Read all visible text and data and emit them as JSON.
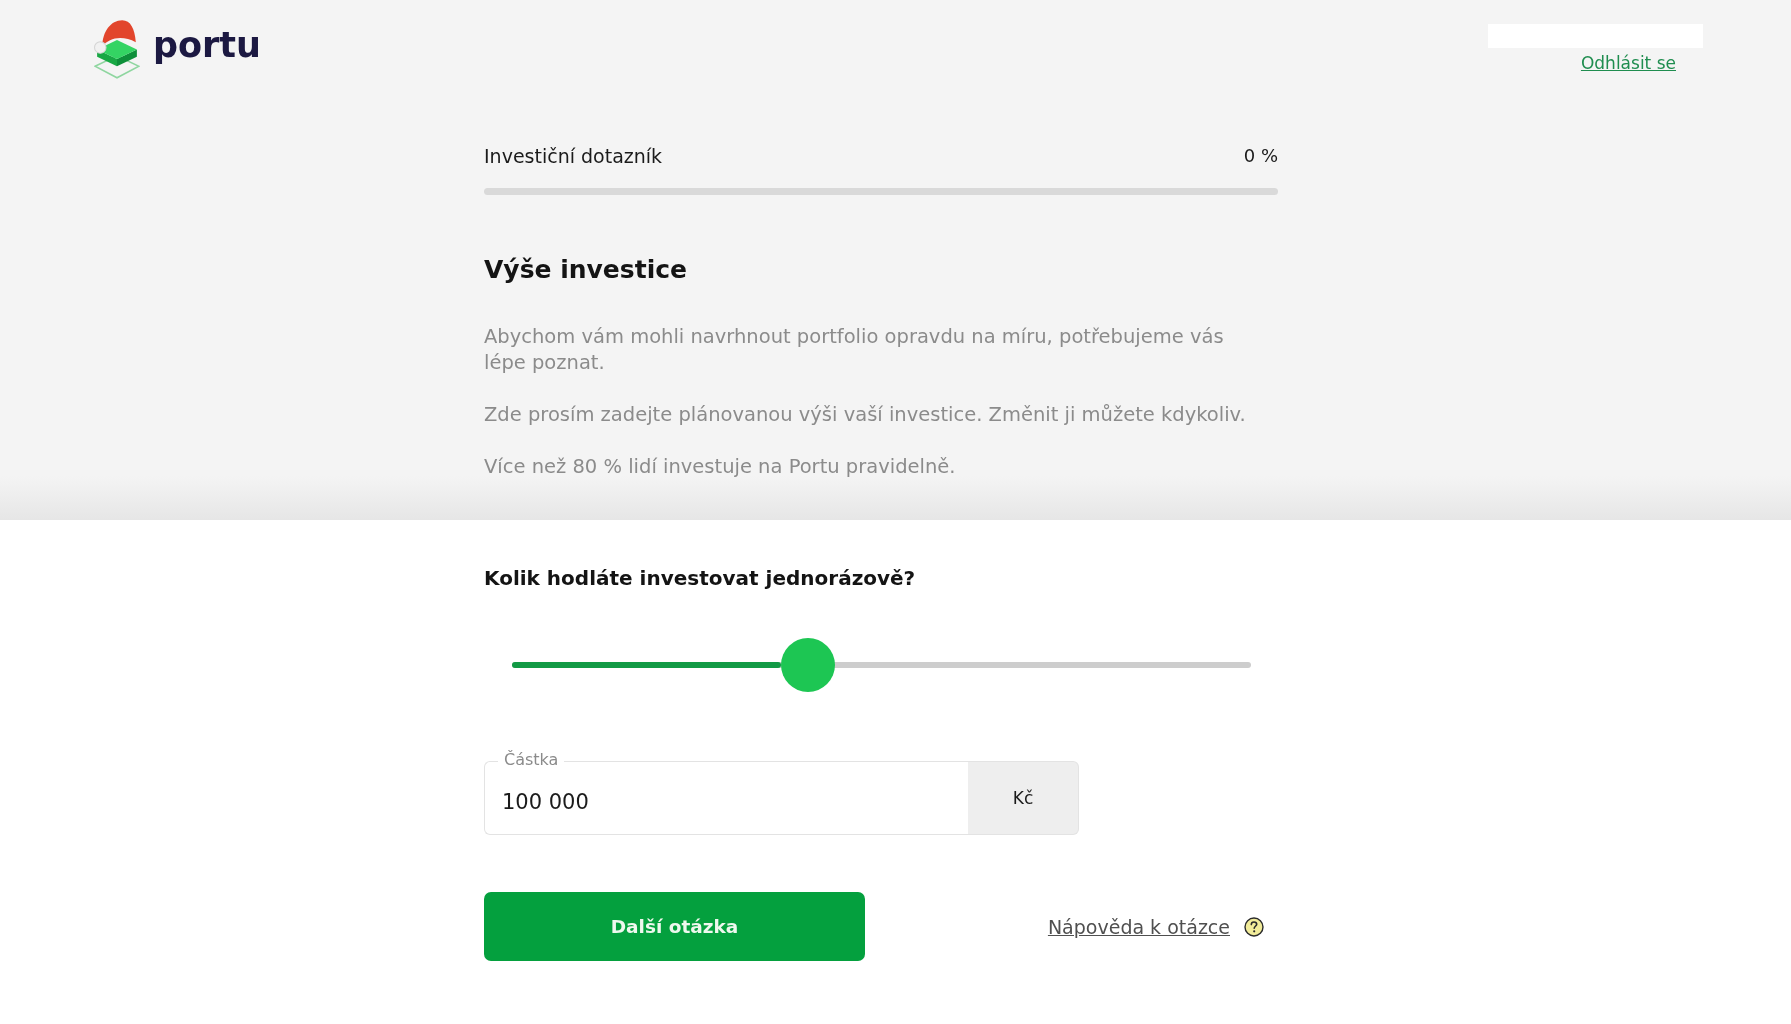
{
  "header": {
    "logo_text": "portu",
    "logout_link": "Odhlásit se"
  },
  "progress": {
    "title": "Investiční dotazník",
    "percent": "0 %",
    "level": 0
  },
  "section": {
    "heading": "Výše investice",
    "paragraphs": [
      "Abychom vám mohli navrhnout portfolio opravdu na míru, potřebujeme vás lépe poznat.",
      "Zde prosím zadejte plánovanou výši vaší investice. Změnit ji můžete kdykoliv.",
      "Více než 80 % lidí investuje na Portu pravidelně."
    ]
  },
  "question": {
    "title": "Kolik hodláte investovat jednorázově?",
    "slider": {
      "level": 0.4
    },
    "amount_field": {
      "label": "Částka",
      "value": "100 000",
      "unit": "Kč"
    }
  },
  "actions": {
    "next_button": "Další otázka",
    "help_link": "Nápověda k otázce"
  }
}
